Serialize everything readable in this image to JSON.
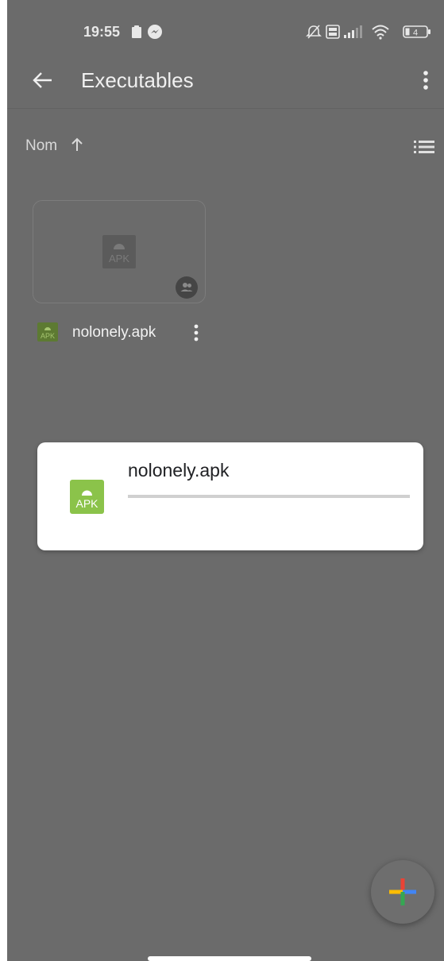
{
  "status_bar": {
    "time": "19:55",
    "battery_level": "4"
  },
  "app_bar": {
    "title": "Executables"
  },
  "sort": {
    "label": "Nom"
  },
  "files": [
    {
      "name": "nolonely.apk",
      "thumb_label": "APK"
    }
  ],
  "dialog": {
    "file_name": "nolonely.apk",
    "icon_label": "APK",
    "progress": 0
  },
  "colors": {
    "scrim": "#6b6b6b",
    "apk_green": "#8bc34a",
    "fab_red": "#ea4335",
    "fab_blue": "#4285f4",
    "fab_yellow": "#fbbc04",
    "fab_green": "#34a853"
  },
  "icons": {
    "back": "arrow-back-icon",
    "overflow": "more-vert-icon",
    "sort_direction": "arrow-up-icon",
    "view_mode": "list-view-icon",
    "shared": "shared-people-icon",
    "fab": "plus-icon"
  }
}
